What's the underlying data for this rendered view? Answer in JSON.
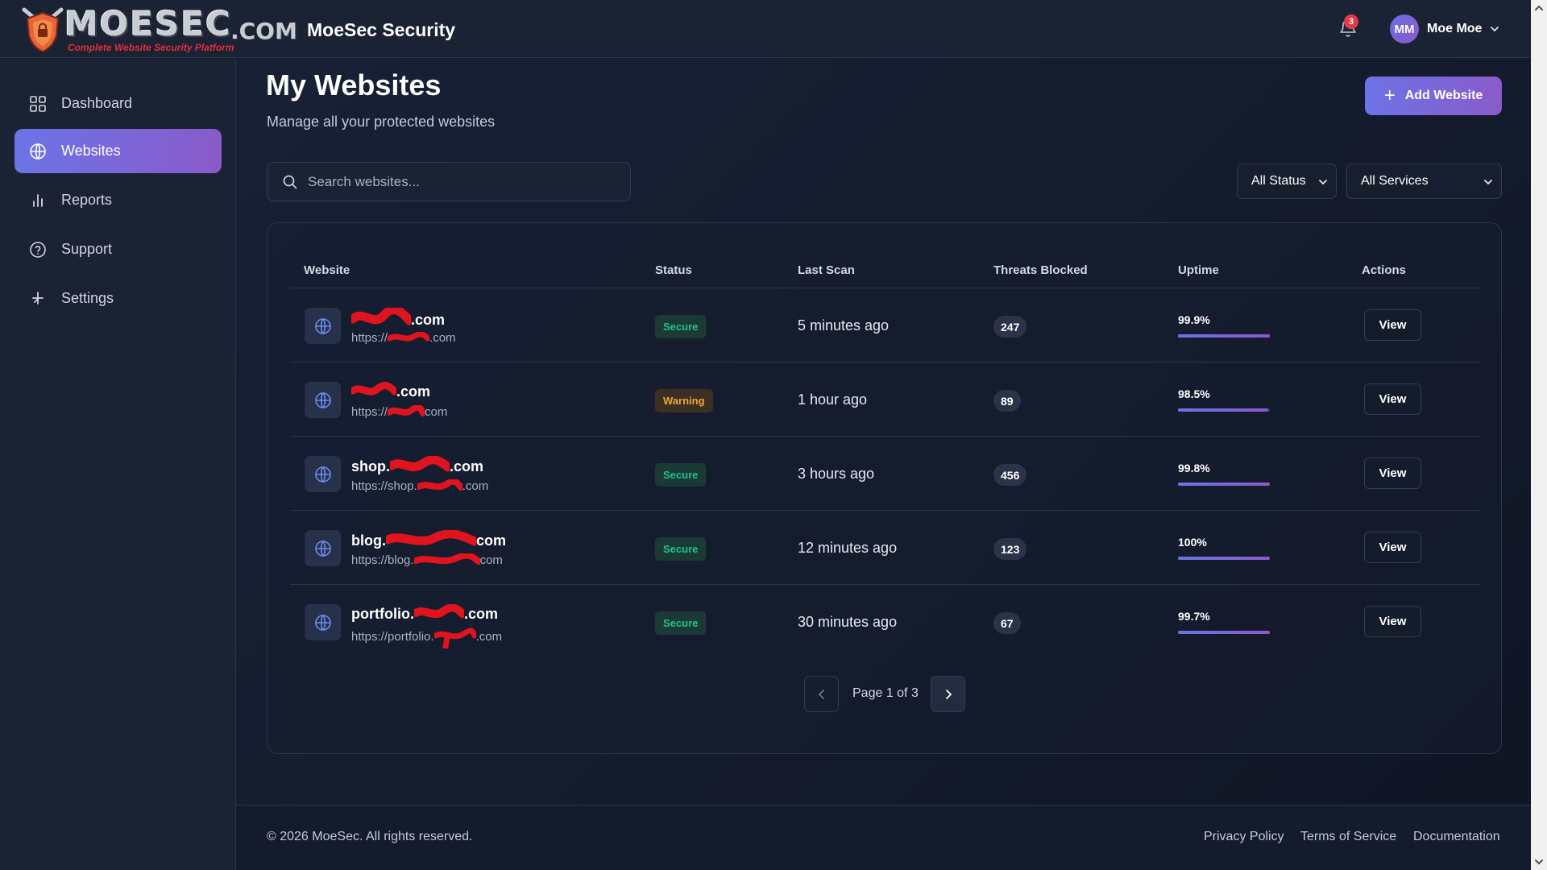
{
  "brand": {
    "logo_text": "MOESEC",
    "logo_suffix": ".COM",
    "logo_tagline": "Complete Website Security Platform",
    "app_title": "MoeSec Security"
  },
  "header": {
    "notification_count": "3",
    "user_initials": "MM",
    "user_name": "Moe Moe"
  },
  "sidebar": {
    "items": [
      {
        "label": "Dashboard",
        "icon": "grid-icon",
        "active": false
      },
      {
        "label": "Websites",
        "icon": "globe-icon",
        "active": true
      },
      {
        "label": "Reports",
        "icon": "bar-chart-icon",
        "active": false
      },
      {
        "label": "Support",
        "icon": "help-circle-icon",
        "active": false
      },
      {
        "label": "Settings",
        "icon": "settings-icon",
        "active": false
      }
    ]
  },
  "page": {
    "title": "My Websites",
    "subtitle": "Manage all your protected websites",
    "add_button": "Add Website"
  },
  "filters": {
    "search_placeholder": "Search websites...",
    "status_select": "All Status",
    "service_select": "All Services"
  },
  "table": {
    "columns": [
      "Website",
      "Status",
      "Last Scan",
      "Threats Blocked",
      "Uptime",
      "Actions"
    ],
    "rows": [
      {
        "name": ".com",
        "url": "https://",
        "url_suffix": ".com",
        "status": "Secure",
        "status_type": "secure",
        "last_scan": "5 minutes ago",
        "threats": "247",
        "uptime": "99.9%",
        "uptime_value": 99.9,
        "action": "View"
      },
      {
        "name": ".com",
        "url": "https://",
        "url_suffix": "com",
        "status": "Warning",
        "status_type": "warning",
        "last_scan": "1 hour ago",
        "threats": "89",
        "uptime": "98.5%",
        "uptime_value": 98.5,
        "action": "View"
      },
      {
        "name": "shop.",
        "name_suffix": ".com",
        "url": "https://shop.",
        "url_suffix": ".com",
        "status": "Secure",
        "status_type": "secure",
        "last_scan": "3 hours ago",
        "threats": "456",
        "uptime": "99.8%",
        "uptime_value": 99.8,
        "action": "View"
      },
      {
        "name": "blog.",
        "name_suffix": "com",
        "url": "https://blog.",
        "url_suffix": "com",
        "status": "Secure",
        "status_type": "secure",
        "last_scan": "12 minutes ago",
        "threats": "123",
        "uptime": "100%",
        "uptime_value": 100,
        "action": "View"
      },
      {
        "name": "portfolio.",
        "name_suffix": ".com",
        "url": "https://portfolio.",
        "url_suffix": ".com",
        "status": "Secure",
        "status_type": "secure",
        "last_scan": "30 minutes ago",
        "threats": "67",
        "uptime": "99.7%",
        "uptime_value": 99.7,
        "action": "View"
      }
    ]
  },
  "pagination": {
    "text": "Page 1 of 3"
  },
  "footer": {
    "copyright": "© 2026 MoeSec. All rights reserved.",
    "links": [
      "Privacy Policy",
      "Terms of Service",
      "Documentation"
    ]
  },
  "colors": {
    "accent_start": "#6b74e6",
    "accent_end": "#8a5ac9",
    "secure": "#1fc38a",
    "warning": "#f2a43a",
    "redaction": "#e0141e"
  }
}
